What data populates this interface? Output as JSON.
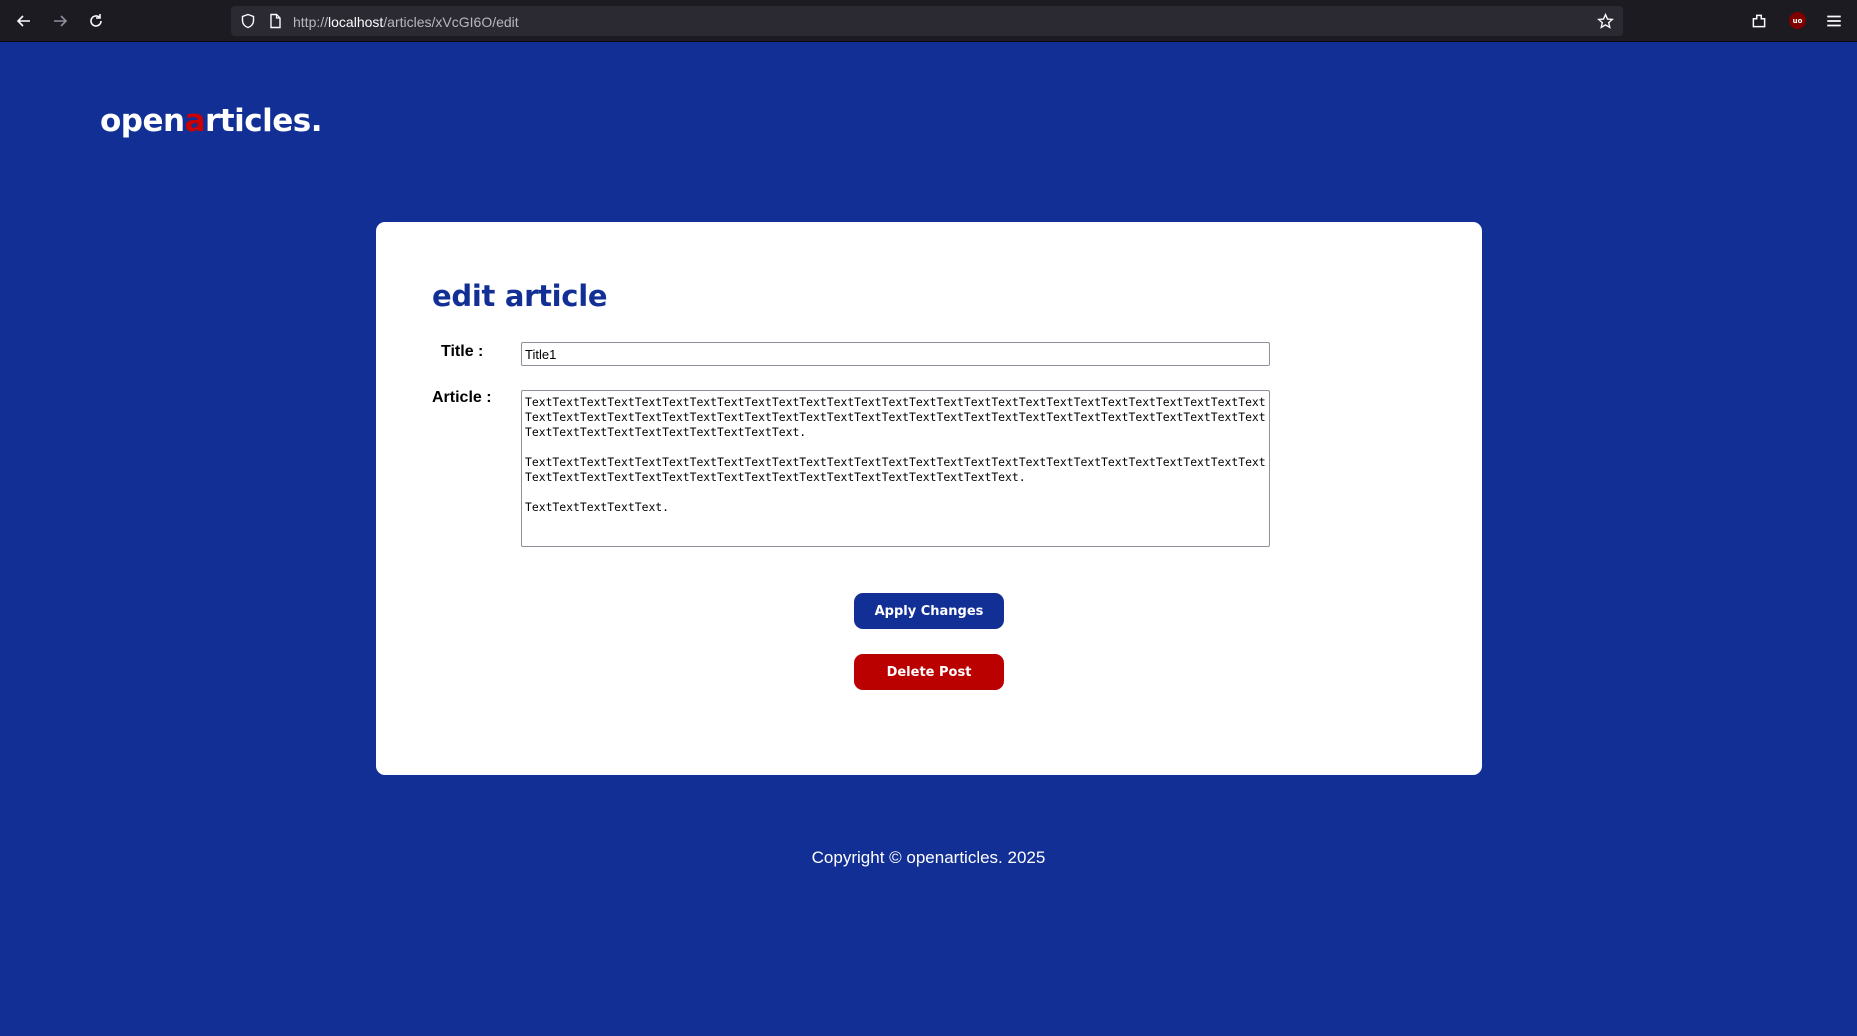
{
  "browser": {
    "url_scheme": "http://",
    "url_host": "localhost",
    "url_path": "/articles/xVcGI6O/edit",
    "icons": [
      "back-icon",
      "forward-icon",
      "reload-icon",
      "shield-icon",
      "page-icon",
      "star-icon",
      "extensions-icon",
      "ublock-icon",
      "menu-icon"
    ]
  },
  "logo": {
    "part1": "open",
    "accent": "a",
    "part2": "rticles."
  },
  "form": {
    "heading": "edit article",
    "title_label": "Title :",
    "title_value": "Title1",
    "article_label": "Article :",
    "article_value": "TextTextTextTextTextTextTextTextTextTextTextTextTextTextTextTextTextTextTextTextTextTextTextTextTextTextTextTextTextTextTextTextTextTextTextTextTextTextTextTextTextTextTextTextTextTextTextTextTextTextTextTextTextTextTextTextTextTextTextTextTextTextTextText.\n\nTextTextTextTextTextTextTextTextTextTextTextTextTextTextTextTextTextTextTextTextTextTextTextTextTextTextTextTextTextTextTextTextTextTextTextTextTextTextTextTextTextTextTextTextText.\n\nTextTextTextTextText.",
    "apply_label": "Apply Changes",
    "delete_label": "Delete Post"
  },
  "footer": {
    "copyright": "Copyright © openarticles. 2025"
  },
  "colors": {
    "background": "#122f95",
    "accent_red": "#cc0000",
    "apply_button": "#122f95",
    "delete_button": "#bb0000"
  }
}
